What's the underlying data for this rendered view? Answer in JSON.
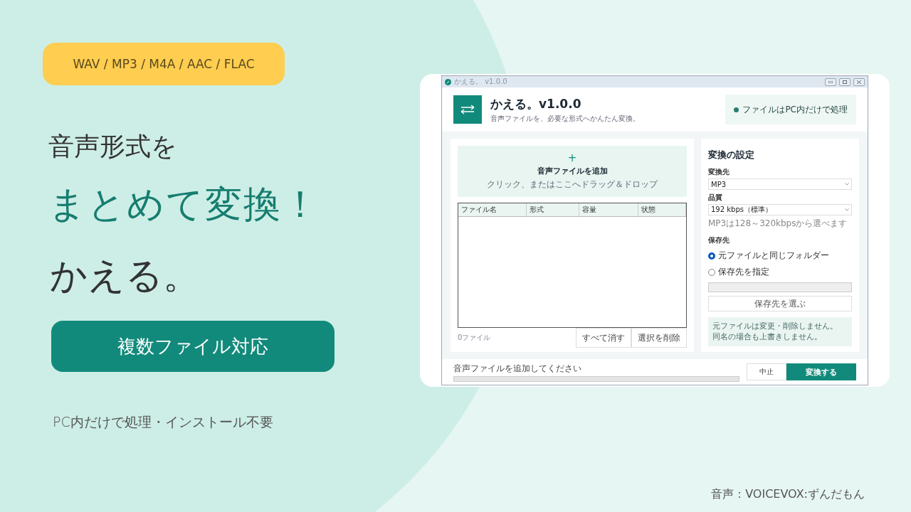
{
  "promo": {
    "formats_badge": "WAV / MP3 / M4A / AAC / FLAC",
    "headline_1": "音声形式を",
    "headline_2": "まとめて変換！",
    "app_name": "かえる。",
    "feature_button": "複数ファイル対応",
    "tagline": "PC内だけで処理・インストール不要",
    "credit": "音声：VOICEVOX:ずんだもん"
  },
  "window": {
    "title": "かえる。 v1.0.0"
  },
  "header": {
    "title": "かえる。v1.0.0",
    "subtitle": "音声ファイルを、必要な形式へかんたん変換。",
    "badge": "ファイルはPC内だけで処理"
  },
  "drop_zone": {
    "icon": "+",
    "title": "音声ファイルを追加",
    "hint": "クリック、またはここへドラッグ＆ドロップ"
  },
  "table": {
    "columns": [
      "ファイル名",
      "形式",
      "容量",
      "状態"
    ]
  },
  "file_count": "0ファイル",
  "list_buttons": [
    "すべて消す",
    "選択を削除"
  ],
  "settings": {
    "title": "変換の設定",
    "format": {
      "label": "変換先",
      "value": "MP3"
    },
    "quality": {
      "label": "品質",
      "value": "192 kbps（標準）",
      "hint": "MP3は128～320kbpsから選べます"
    },
    "output": {
      "label": "保存先",
      "options": [
        {
          "label": "元ファイルと同じフォルダー",
          "selected": true
        },
        {
          "label": "保存先を指定",
          "selected": false
        }
      ],
      "choose_button": "保存先を選ぶ"
    },
    "note": [
      "元ファイルは変更・削除しません。",
      "同名の場合も上書きしません。"
    ]
  },
  "status": {
    "text": "音声ファイルを追加してください",
    "level": 0
  },
  "actions": {
    "cancel": "中止",
    "convert": "変換する"
  }
}
